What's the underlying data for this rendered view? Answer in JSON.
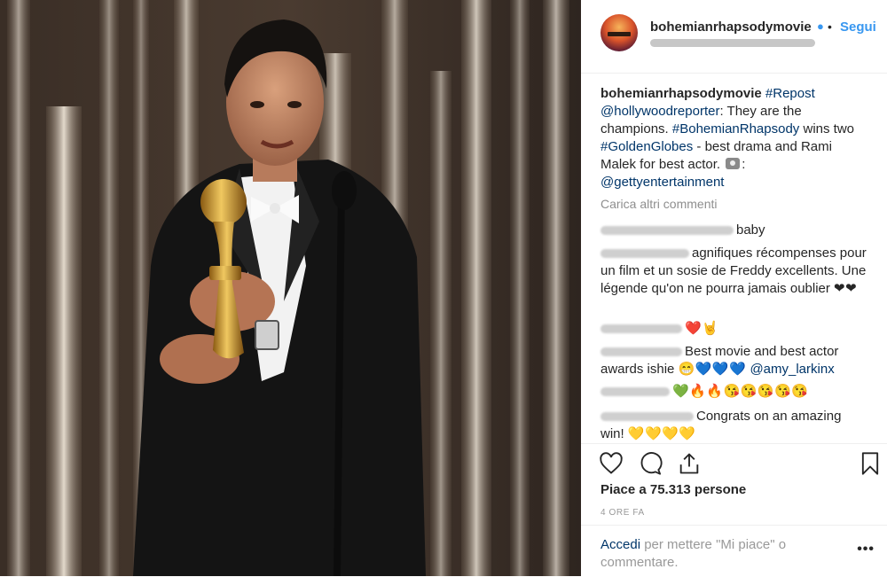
{
  "post": {
    "author": "bohemianrhapsodymovie",
    "verified_icon": "verified-badge-icon",
    "follow_label": "Segui",
    "caption": {
      "author": "bohemianrhapsodymovie",
      "hashtag_repost": "#Repost",
      "mention": "@hollywoodreporter",
      "text1": ": They are the champions. ",
      "hashtag_movie": "#BohemianRhapsody",
      "text2": " wins two ",
      "hashtag_globes": "#GoldenGlobes",
      "text3": " - best drama and Rami Malek for best actor. ",
      "text4": ":",
      "credit": "@gettyentertainment"
    },
    "load_more": "Carica altri commenti",
    "comments": [
      {
        "text": "baby",
        "emoji": ""
      },
      {
        "text": "agnifiques récompenses pour un film et un sosie de Freddy excellents. Une légende qu'on ne pourra jamais oublier",
        "emoji": "❤❤"
      },
      {
        "text": "",
        "emoji": "❤️🤘"
      },
      {
        "text": "Best movie and best actor awards ishie",
        "emoji": "😁💙💙💙",
        "mention": "@amy_larkinx"
      },
      {
        "text": "",
        "emoji": "💚🔥🔥😘😘😘😘😘"
      },
      {
        "text": "Congrats on an amazing win!",
        "emoji": "💛💛💛💛"
      }
    ],
    "likes": "Piace a 75.313 persone",
    "time": "4 ORE FA",
    "login": {
      "link": "Accedi",
      "text": " per mettere \"Mi piace\" o commentare.",
      "more": "•••"
    }
  },
  "icons": [
    "heart-icon",
    "comment-icon",
    "share-icon",
    "bookmark-icon",
    "more-options-icon"
  ]
}
